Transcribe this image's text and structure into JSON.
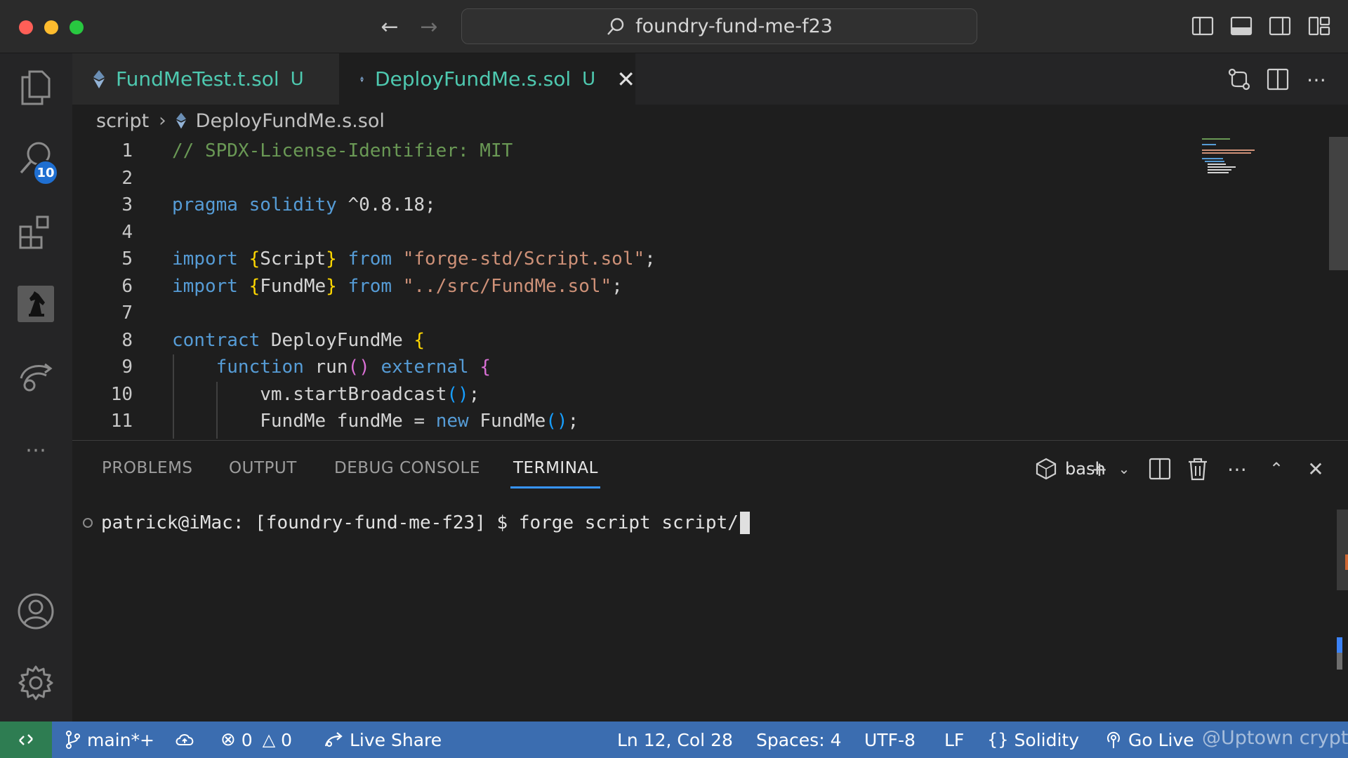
{
  "window": {
    "command_center": "foundry-fund-me-f23"
  },
  "activity_bar": {
    "search_badge": "10"
  },
  "tabs": [
    {
      "label": "FundMeTest.t.sol",
      "status": "U"
    },
    {
      "label": "DeployFundMe.s.sol",
      "status": "U"
    }
  ],
  "breadcrumb": {
    "folder": "script",
    "file": "DeployFundMe.s.sol"
  },
  "editor": {
    "line_numbers": [
      "1",
      "2",
      "3",
      "4",
      "5",
      "6",
      "7",
      "8",
      "9",
      "10",
      "11"
    ],
    "code": {
      "l1": "// SPDX-License-Identifier: MIT",
      "l3_kw1": "pragma",
      "l3_kw2": "solidity",
      "l3_ver": " ^0.8.18;",
      "import": "import",
      "from": "from",
      "l5_name": "Script",
      "l5_path": "\"forge-std/Script.sol\"",
      "l6_name": "FundMe",
      "l6_path": "\"../src/FundMe.sol\"",
      "contract": "contract",
      "contract_name": "DeployFundMe",
      "function": "function",
      "run": "run",
      "external": "external",
      "l10_call": "vm.startBroadcast",
      "l11_type": "FundMe",
      "l11_var": " fundMe = ",
      "new": "new",
      "l11_ctor": " FundMe"
    }
  },
  "panel": {
    "tabs": [
      "PROBLEMS",
      "OUTPUT",
      "DEBUG CONSOLE",
      "TERMINAL"
    ],
    "active_tab": "TERMINAL",
    "shell": "bash",
    "terminal_line": "patrick@iMac: [foundry-fund-me-f23] $ forge script script/"
  },
  "status_bar": {
    "branch": "main*+",
    "errors": "0",
    "warnings": "0",
    "live_share": "Live Share",
    "cursor_pos": "Ln 12, Col 28",
    "spaces": "Spaces: 4",
    "encoding": "UTF-8",
    "eol": "LF",
    "language": "Solidity",
    "go_live": "Go Live",
    "watermark": "@Uptown crypto"
  },
  "colors": {
    "accent": "#3794ff",
    "status_bar": "#3b6db0",
    "remote": "#2e7d52",
    "comment": "#6a9955",
    "keyword": "#569cd6",
    "string": "#ce9178",
    "modified": "#4ec9b0"
  }
}
